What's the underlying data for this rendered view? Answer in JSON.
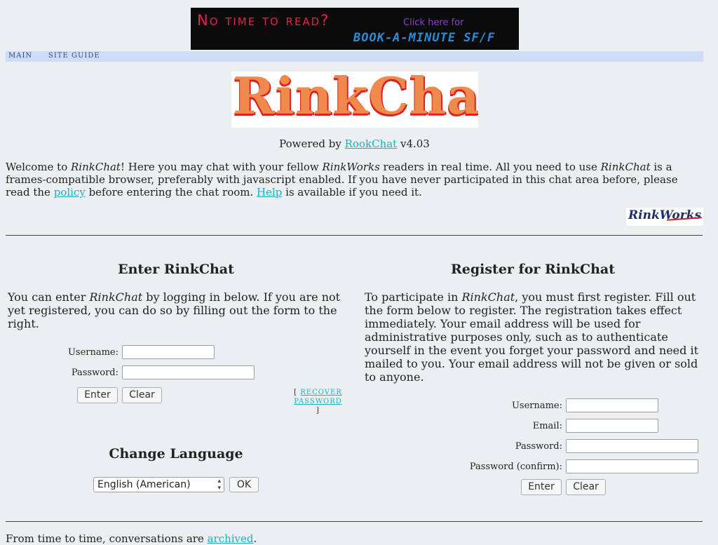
{
  "banner": {
    "headline": "No time to read?",
    "cta": "Click here for",
    "product": "BOOK-A-MINUTE SF/F"
  },
  "nav": {
    "items": [
      "MAIN",
      "SITE GUIDE"
    ]
  },
  "logo": {
    "text": "RinkChat"
  },
  "powered": {
    "prefix": "Powered by ",
    "link": "RookChat",
    "suffix": " v4.03"
  },
  "welcome": {
    "t1": "Welcome to ",
    "e1": "RinkChat",
    "t2": "! Here you may chat with your fellow ",
    "e2": "RinkWorks",
    "t3": " readers in real time. All you need to use ",
    "e3": "RinkChat",
    "t4": " is a frames-compatible browser, preferably with javascript enabled. If you have never participated in this chat area before, please read the ",
    "policy_link": "policy",
    "t5": " before entering the chat room. ",
    "help_link": "Help",
    "t6": " is available if you need it."
  },
  "rinkworks_logo": {
    "text": "RinkWorks"
  },
  "enter": {
    "title": "Enter RinkChat",
    "p1": "You can enter ",
    "pe": "RinkChat",
    "p2": " by logging in below. If you are not yet registered, you can do so by filling out the form to the right.",
    "username_label": "Username:",
    "password_label": "Password:",
    "enter_button": "Enter",
    "clear_button": "Clear",
    "recover_open": "[ ",
    "recover_link": "RECOVER PASSWORD",
    "recover_close": " ]"
  },
  "language": {
    "title": "Change Language",
    "selected": "English (American)",
    "ok_button": "OK"
  },
  "register": {
    "title": "Register for RinkChat",
    "p1": "To participate in ",
    "pe": "RinkChat",
    "p2": ", you must first register. Fill out the form below to register. The registration takes effect immediately. Your email address will be used for administrative purposes only, such as to authenticate yourself in the event you forget your password and need it mailed to you. Your email address will not be given or sold to anyone.",
    "username_label": "Username:",
    "email_label": "Email:",
    "password_label": "Password:",
    "confirm_label": "Password (confirm):",
    "enter_button": "Enter",
    "clear_button": "Clear"
  },
  "footer": {
    "text": "From time to time, conversations are ",
    "link": "archived",
    "tail": "."
  }
}
